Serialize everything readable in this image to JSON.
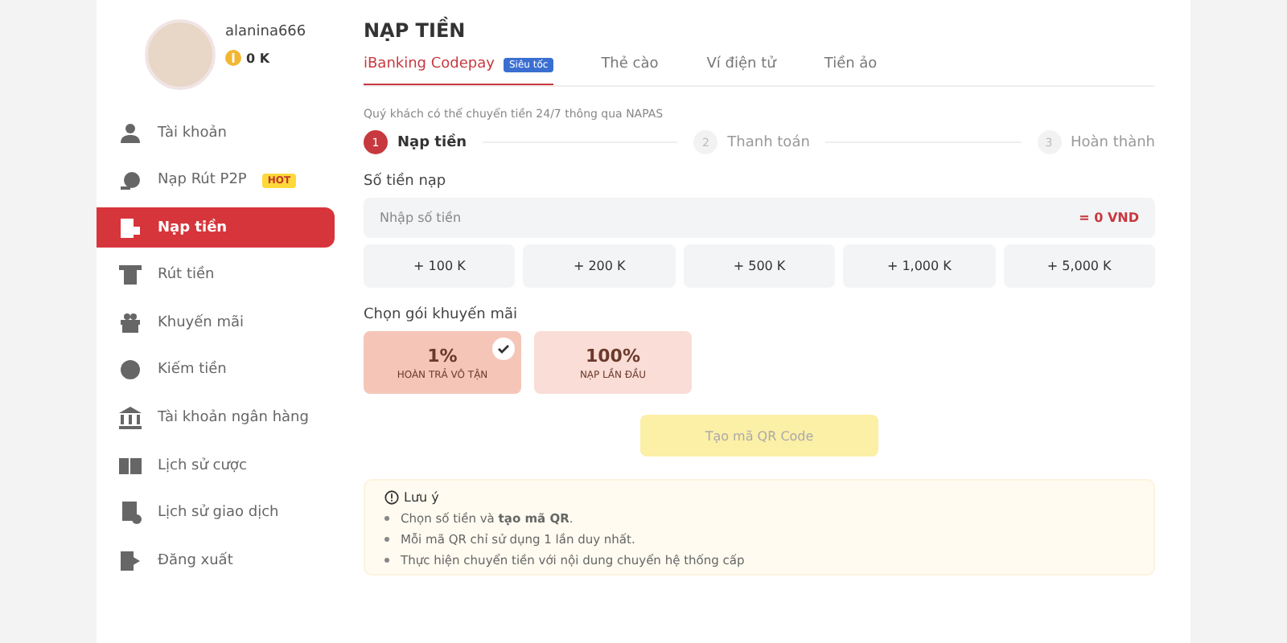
{
  "profile": {
    "username": "alanina666",
    "balance": "0 K"
  },
  "sidebar": {
    "items": [
      {
        "label": "Tài khoản",
        "selected": false
      },
      {
        "label": "Nạp Rút P2P",
        "badge": "HOT",
        "selected": false
      },
      {
        "label": "Nạp tiền",
        "selected": true
      },
      {
        "label": "Rút tiền",
        "selected": false
      },
      {
        "label": "Khuyến mãi",
        "selected": false
      },
      {
        "label": "Kiếm tiền",
        "selected": false
      },
      {
        "label": "Tài khoản ngân hàng",
        "selected": false
      },
      {
        "label": "Lịch sử cược",
        "selected": false
      },
      {
        "label": "Lịch sử giao dịch",
        "selected": false
      },
      {
        "label": "Đăng xuất",
        "selected": false
      }
    ]
  },
  "page_title": "NẠP TIỀN",
  "tabs": [
    {
      "label": "iBanking Codepay",
      "badge": "Siêu tốc",
      "selected": true
    },
    {
      "label": "Thẻ cào",
      "selected": false
    },
    {
      "label": "Ví điện tử",
      "selected": false
    },
    {
      "label": "Tiền ảo",
      "selected": false
    }
  ],
  "notice": "Quý khách có thể chuyển tiền 24/7 thông qua NAPAS",
  "steps": [
    {
      "number": "1",
      "label": "Nạp tiền",
      "selected": true
    },
    {
      "number": "2",
      "label": "Thanh toán",
      "selected": false
    },
    {
      "number": "3",
      "label": "Hoàn thành",
      "selected": false
    }
  ],
  "amount": {
    "label": "Số tiền nạp",
    "placeholder": "Nhập số tiền",
    "converted": "= 0 VND"
  },
  "quick_amounts": [
    "+ 100 K",
    "+ 200 K",
    "+ 500 K",
    "+ 1,000 K",
    "+ 5,000 K"
  ],
  "promo_label": "Chọn gói khuyến mãi",
  "promos": [
    {
      "value": "1%",
      "name": "HOÀN TRẢ VÔ TẬN",
      "selected": true
    },
    {
      "value": "100%",
      "name": "NẠP LẦN ĐẦU",
      "selected": false
    }
  ],
  "submit": {
    "label": "Tạo mã QR Code",
    "disabled": true
  },
  "note": {
    "title": "Lưu ý",
    "items": [
      "Chọn số tiền và **tạo mã QR**.",
      "Mỗi mã QR chỉ sử dụng 1 lần duy nhất.",
      "Thực hiện chuyển tiền với nội dung chuyển hệ thống cấp"
    ]
  }
}
